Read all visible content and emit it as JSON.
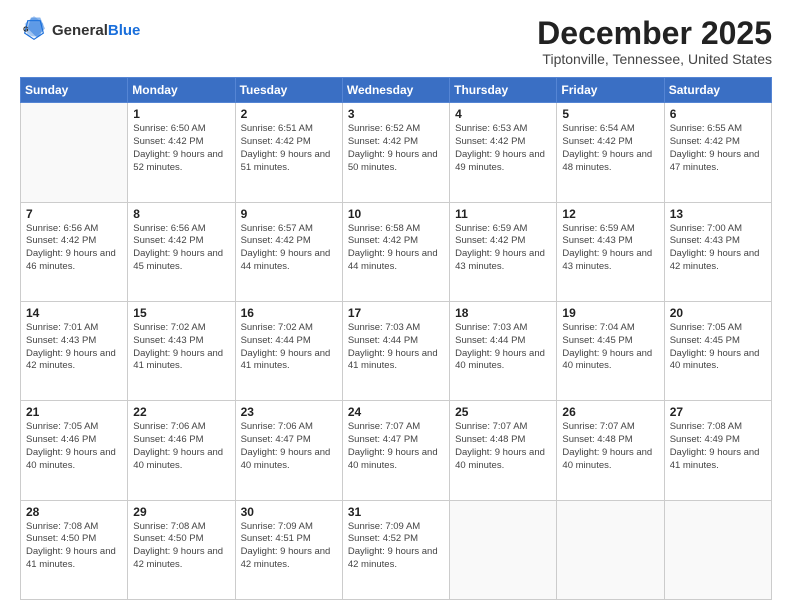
{
  "logo": {
    "general": "General",
    "blue": "Blue"
  },
  "header": {
    "month": "December 2025",
    "location": "Tiptonville, Tennessee, United States"
  },
  "weekdays": [
    "Sunday",
    "Monday",
    "Tuesday",
    "Wednesday",
    "Thursday",
    "Friday",
    "Saturday"
  ],
  "weeks": [
    [
      {
        "day": "",
        "sunrise": "",
        "sunset": "",
        "daylight": ""
      },
      {
        "day": "1",
        "sunrise": "Sunrise: 6:50 AM",
        "sunset": "Sunset: 4:42 PM",
        "daylight": "Daylight: 9 hours and 52 minutes."
      },
      {
        "day": "2",
        "sunrise": "Sunrise: 6:51 AM",
        "sunset": "Sunset: 4:42 PM",
        "daylight": "Daylight: 9 hours and 51 minutes."
      },
      {
        "day": "3",
        "sunrise": "Sunrise: 6:52 AM",
        "sunset": "Sunset: 4:42 PM",
        "daylight": "Daylight: 9 hours and 50 minutes."
      },
      {
        "day": "4",
        "sunrise": "Sunrise: 6:53 AM",
        "sunset": "Sunset: 4:42 PM",
        "daylight": "Daylight: 9 hours and 49 minutes."
      },
      {
        "day": "5",
        "sunrise": "Sunrise: 6:54 AM",
        "sunset": "Sunset: 4:42 PM",
        "daylight": "Daylight: 9 hours and 48 minutes."
      },
      {
        "day": "6",
        "sunrise": "Sunrise: 6:55 AM",
        "sunset": "Sunset: 4:42 PM",
        "daylight": "Daylight: 9 hours and 47 minutes."
      }
    ],
    [
      {
        "day": "7",
        "sunrise": "Sunrise: 6:56 AM",
        "sunset": "Sunset: 4:42 PM",
        "daylight": "Daylight: 9 hours and 46 minutes."
      },
      {
        "day": "8",
        "sunrise": "Sunrise: 6:56 AM",
        "sunset": "Sunset: 4:42 PM",
        "daylight": "Daylight: 9 hours and 45 minutes."
      },
      {
        "day": "9",
        "sunrise": "Sunrise: 6:57 AM",
        "sunset": "Sunset: 4:42 PM",
        "daylight": "Daylight: 9 hours and 44 minutes."
      },
      {
        "day": "10",
        "sunrise": "Sunrise: 6:58 AM",
        "sunset": "Sunset: 4:42 PM",
        "daylight": "Daylight: 9 hours and 44 minutes."
      },
      {
        "day": "11",
        "sunrise": "Sunrise: 6:59 AM",
        "sunset": "Sunset: 4:42 PM",
        "daylight": "Daylight: 9 hours and 43 minutes."
      },
      {
        "day": "12",
        "sunrise": "Sunrise: 6:59 AM",
        "sunset": "Sunset: 4:43 PM",
        "daylight": "Daylight: 9 hours and 43 minutes."
      },
      {
        "day": "13",
        "sunrise": "Sunrise: 7:00 AM",
        "sunset": "Sunset: 4:43 PM",
        "daylight": "Daylight: 9 hours and 42 minutes."
      }
    ],
    [
      {
        "day": "14",
        "sunrise": "Sunrise: 7:01 AM",
        "sunset": "Sunset: 4:43 PM",
        "daylight": "Daylight: 9 hours and 42 minutes."
      },
      {
        "day": "15",
        "sunrise": "Sunrise: 7:02 AM",
        "sunset": "Sunset: 4:43 PM",
        "daylight": "Daylight: 9 hours and 41 minutes."
      },
      {
        "day": "16",
        "sunrise": "Sunrise: 7:02 AM",
        "sunset": "Sunset: 4:44 PM",
        "daylight": "Daylight: 9 hours and 41 minutes."
      },
      {
        "day": "17",
        "sunrise": "Sunrise: 7:03 AM",
        "sunset": "Sunset: 4:44 PM",
        "daylight": "Daylight: 9 hours and 41 minutes."
      },
      {
        "day": "18",
        "sunrise": "Sunrise: 7:03 AM",
        "sunset": "Sunset: 4:44 PM",
        "daylight": "Daylight: 9 hours and 40 minutes."
      },
      {
        "day": "19",
        "sunrise": "Sunrise: 7:04 AM",
        "sunset": "Sunset: 4:45 PM",
        "daylight": "Daylight: 9 hours and 40 minutes."
      },
      {
        "day": "20",
        "sunrise": "Sunrise: 7:05 AM",
        "sunset": "Sunset: 4:45 PM",
        "daylight": "Daylight: 9 hours and 40 minutes."
      }
    ],
    [
      {
        "day": "21",
        "sunrise": "Sunrise: 7:05 AM",
        "sunset": "Sunset: 4:46 PM",
        "daylight": "Daylight: 9 hours and 40 minutes."
      },
      {
        "day": "22",
        "sunrise": "Sunrise: 7:06 AM",
        "sunset": "Sunset: 4:46 PM",
        "daylight": "Daylight: 9 hours and 40 minutes."
      },
      {
        "day": "23",
        "sunrise": "Sunrise: 7:06 AM",
        "sunset": "Sunset: 4:47 PM",
        "daylight": "Daylight: 9 hours and 40 minutes."
      },
      {
        "day": "24",
        "sunrise": "Sunrise: 7:07 AM",
        "sunset": "Sunset: 4:47 PM",
        "daylight": "Daylight: 9 hours and 40 minutes."
      },
      {
        "day": "25",
        "sunrise": "Sunrise: 7:07 AM",
        "sunset": "Sunset: 4:48 PM",
        "daylight": "Daylight: 9 hours and 40 minutes."
      },
      {
        "day": "26",
        "sunrise": "Sunrise: 7:07 AM",
        "sunset": "Sunset: 4:48 PM",
        "daylight": "Daylight: 9 hours and 40 minutes."
      },
      {
        "day": "27",
        "sunrise": "Sunrise: 7:08 AM",
        "sunset": "Sunset: 4:49 PM",
        "daylight": "Daylight: 9 hours and 41 minutes."
      }
    ],
    [
      {
        "day": "28",
        "sunrise": "Sunrise: 7:08 AM",
        "sunset": "Sunset: 4:50 PM",
        "daylight": "Daylight: 9 hours and 41 minutes."
      },
      {
        "day": "29",
        "sunrise": "Sunrise: 7:08 AM",
        "sunset": "Sunset: 4:50 PM",
        "daylight": "Daylight: 9 hours and 42 minutes."
      },
      {
        "day": "30",
        "sunrise": "Sunrise: 7:09 AM",
        "sunset": "Sunset: 4:51 PM",
        "daylight": "Daylight: 9 hours and 42 minutes."
      },
      {
        "day": "31",
        "sunrise": "Sunrise: 7:09 AM",
        "sunset": "Sunset: 4:52 PM",
        "daylight": "Daylight: 9 hours and 42 minutes."
      },
      {
        "day": "",
        "sunrise": "",
        "sunset": "",
        "daylight": ""
      },
      {
        "day": "",
        "sunrise": "",
        "sunset": "",
        "daylight": ""
      },
      {
        "day": "",
        "sunrise": "",
        "sunset": "",
        "daylight": ""
      }
    ]
  ]
}
